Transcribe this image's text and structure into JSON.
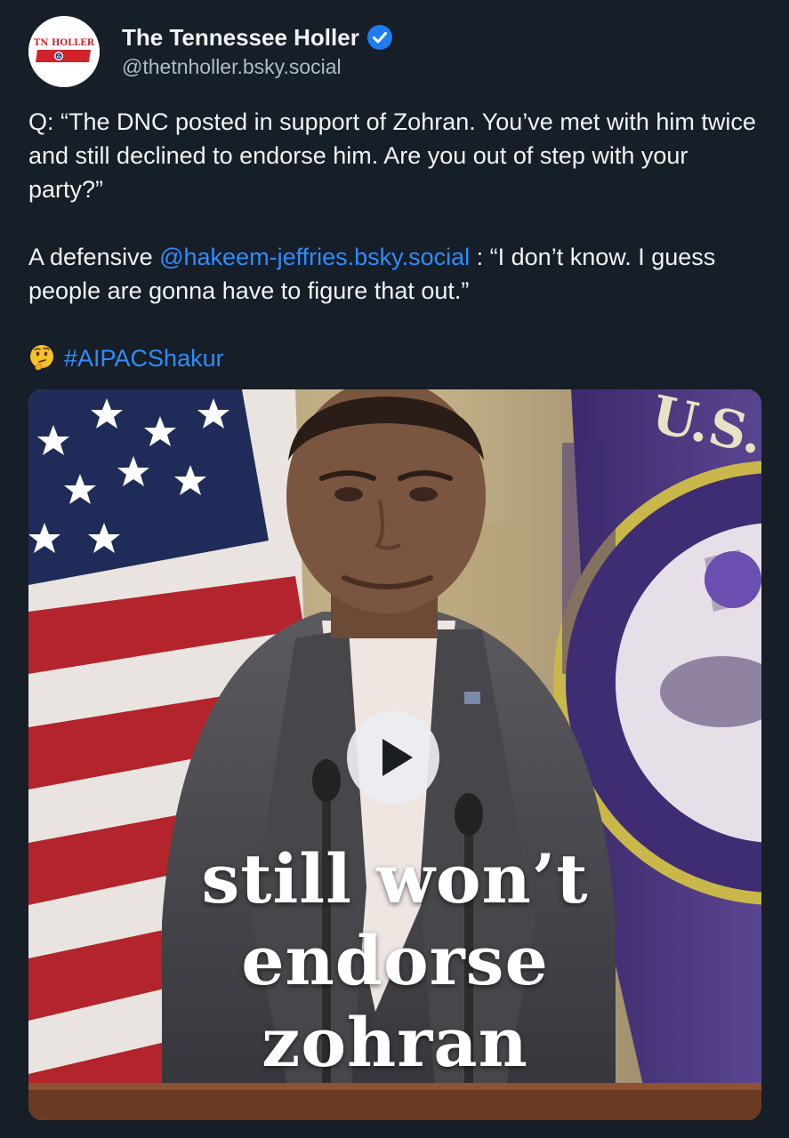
{
  "post": {
    "author": {
      "display_name": "The Tennessee Holler",
      "handle": "@thetnholler.bsky.social",
      "avatar_text": "TN HOLLER",
      "verified": true
    },
    "text": {
      "paragraph1": "Q: “The DNC posted in support of Zohran. You’ve met with him twice and still declined to endorse him. Are you out of step with your party?”",
      "paragraph2_prefix": "A defensive ",
      "mention": "@hakeem-jeffries.bsky.social",
      "paragraph2_suffix": " : “I don’t know. I guess people are gonna have to figure that out.”",
      "emoji": "thinking-face-emoji",
      "hashtag": "#AIPACShakur"
    },
    "video": {
      "caption_lines": [
        "still won’t",
        "endorse",
        "zohran"
      ],
      "seal_text": "U.S."
    }
  },
  "colors": {
    "background": "#161e27",
    "text": "#f1f3f5",
    "secondary_text": "#aebbc9",
    "link": "#2f8cff",
    "verified_badge": "#1f7cf0"
  },
  "icons": {
    "verified": "verified-check-icon",
    "play": "play-icon"
  }
}
